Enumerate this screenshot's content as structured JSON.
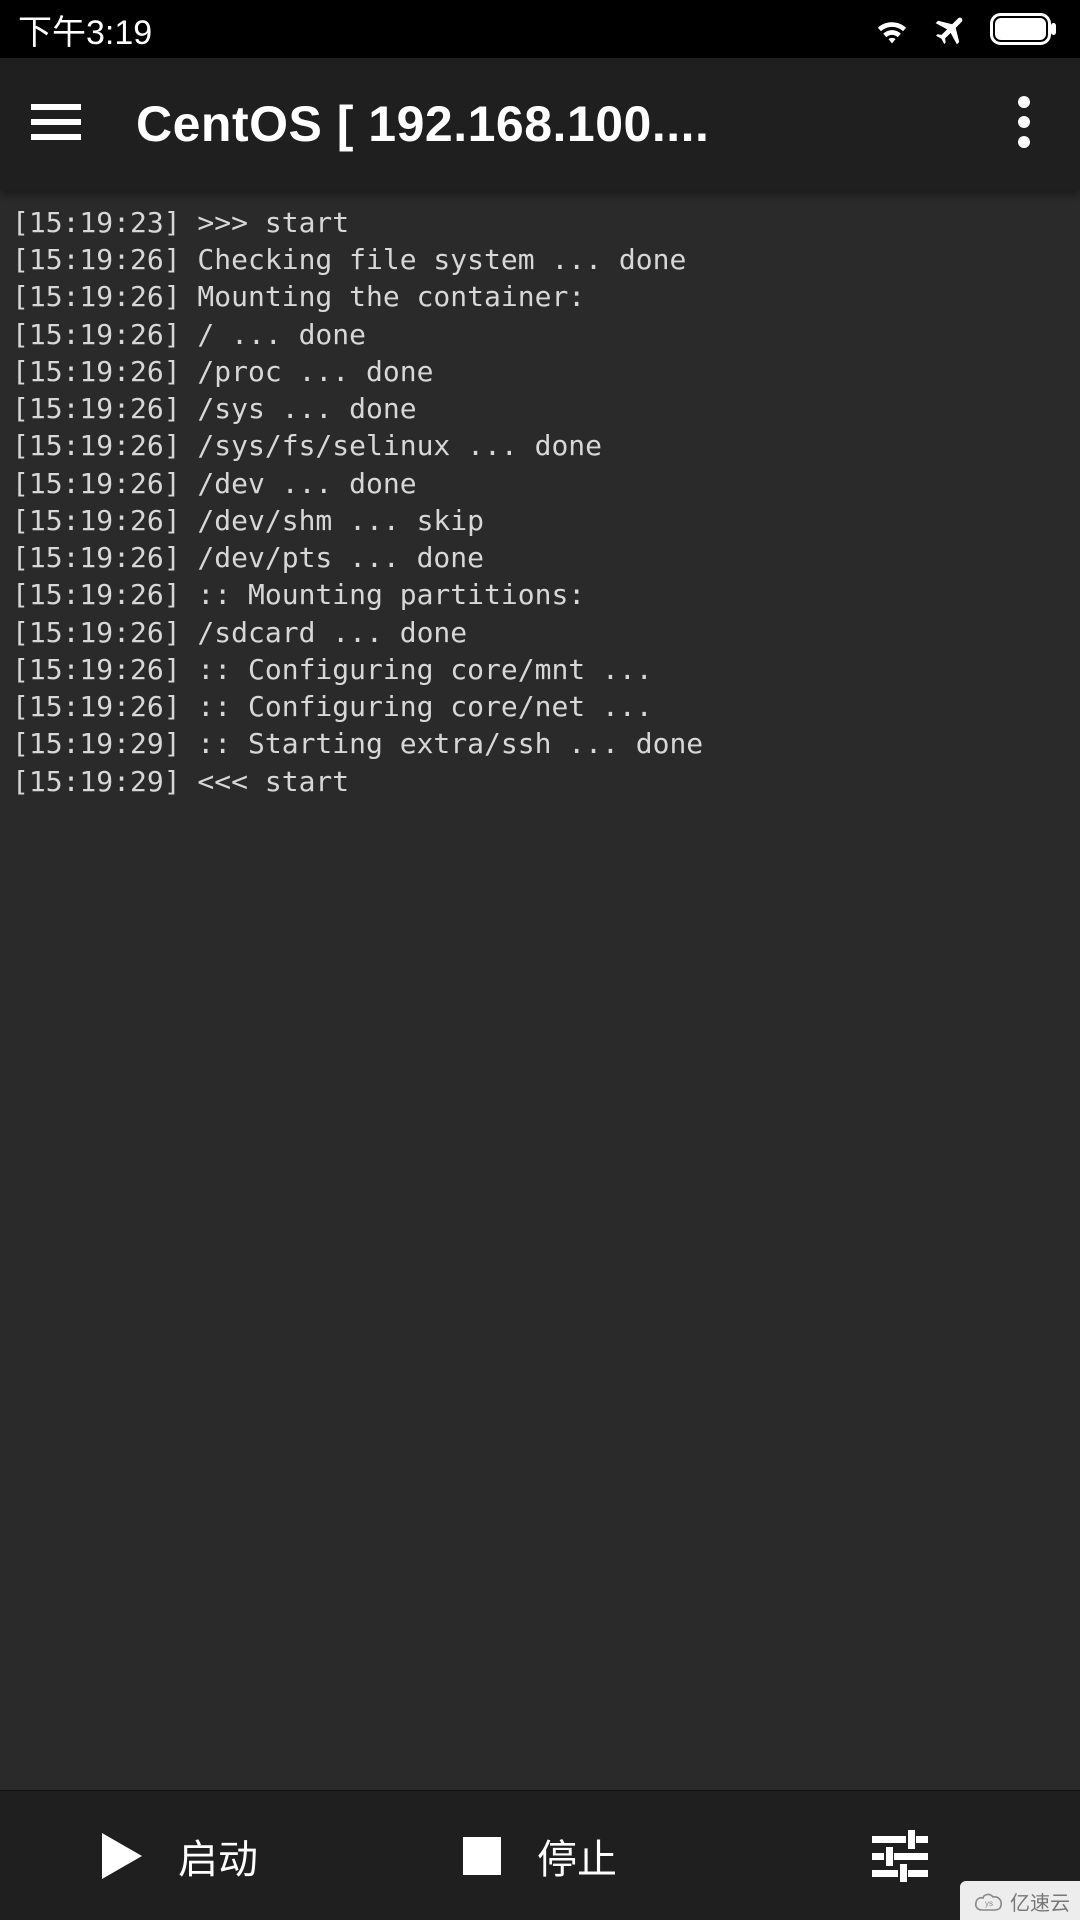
{
  "status_bar": {
    "time": "下午3:19"
  },
  "app_bar": {
    "title": "CentOS  [ 192.168.100...."
  },
  "console_lines": [
    "[15:19:23] >>> start",
    "[15:19:26] Checking file system ... done",
    "[15:19:26] Mounting the container:",
    "[15:19:26] / ... done",
    "[15:19:26] /proc ... done",
    "[15:19:26] /sys ... done",
    "[15:19:26] /sys/fs/selinux ... done",
    "[15:19:26] /dev ... done",
    "[15:19:26] /dev/shm ... skip",
    "[15:19:26] /dev/pts ... done",
    "[15:19:26] :: Mounting partitions:",
    "[15:19:26] /sdcard ... done",
    "[15:19:26] :: Configuring core/mnt ...",
    "[15:19:26] :: Configuring core/net ...",
    "[15:19:29] :: Starting extra/ssh ... done",
    "[15:19:29] <<< start"
  ],
  "bottom_bar": {
    "start_label": "启动",
    "stop_label": "停止"
  },
  "watermark": {
    "text": "亿速云"
  }
}
